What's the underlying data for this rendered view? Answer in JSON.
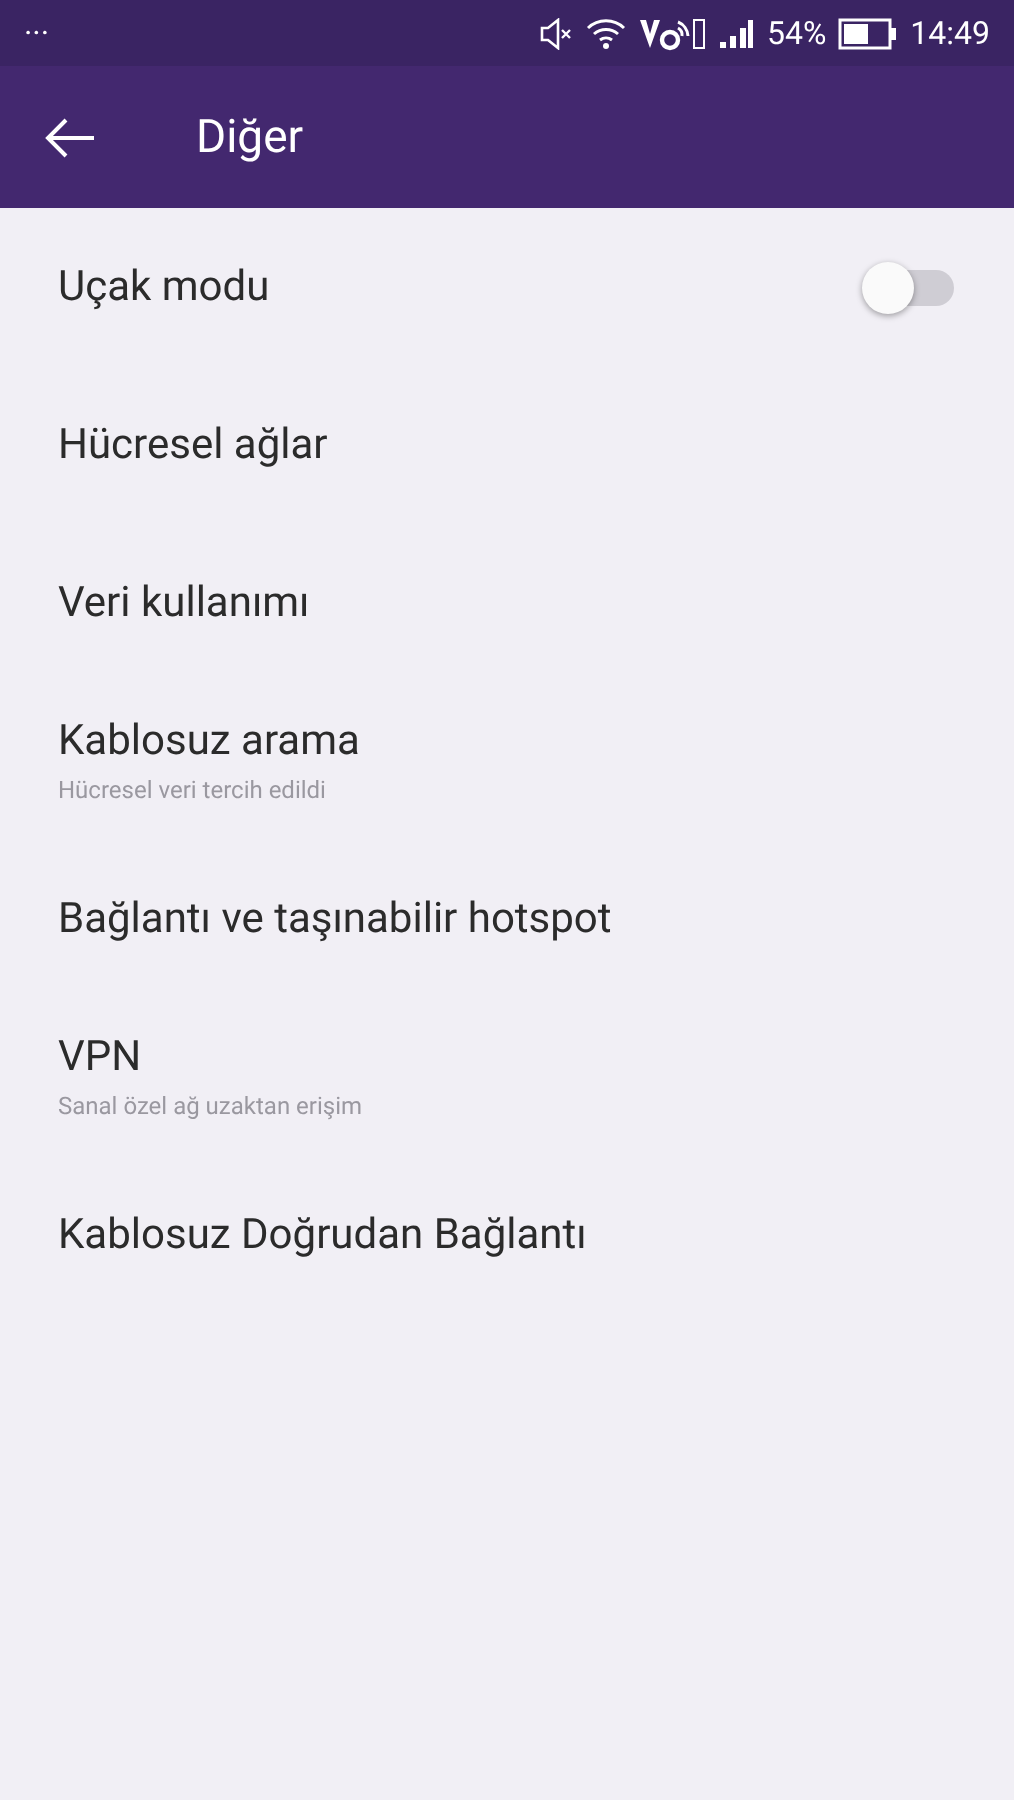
{
  "status_bar": {
    "overflow": "···",
    "battery": "54%",
    "time": "14:49"
  },
  "toolbar": {
    "title": "Diğer"
  },
  "items": [
    {
      "kind": "toggle",
      "label": "Uçak modu",
      "on": false
    },
    {
      "kind": "plain",
      "label": "Hücresel ağlar"
    },
    {
      "kind": "plain",
      "label": "Veri kullanımı"
    },
    {
      "kind": "plain",
      "label": "Kablosuz arama",
      "subtitle": "Hücresel veri tercih edildi"
    },
    {
      "kind": "plain",
      "label": "Bağlantı ve taşınabilir hotspot"
    },
    {
      "kind": "plain",
      "label": "VPN",
      "subtitle": "Sanal özel ağ uzaktan erişim"
    },
    {
      "kind": "plain",
      "label": "Kablosuz Doğrudan Bağlantı"
    }
  ]
}
